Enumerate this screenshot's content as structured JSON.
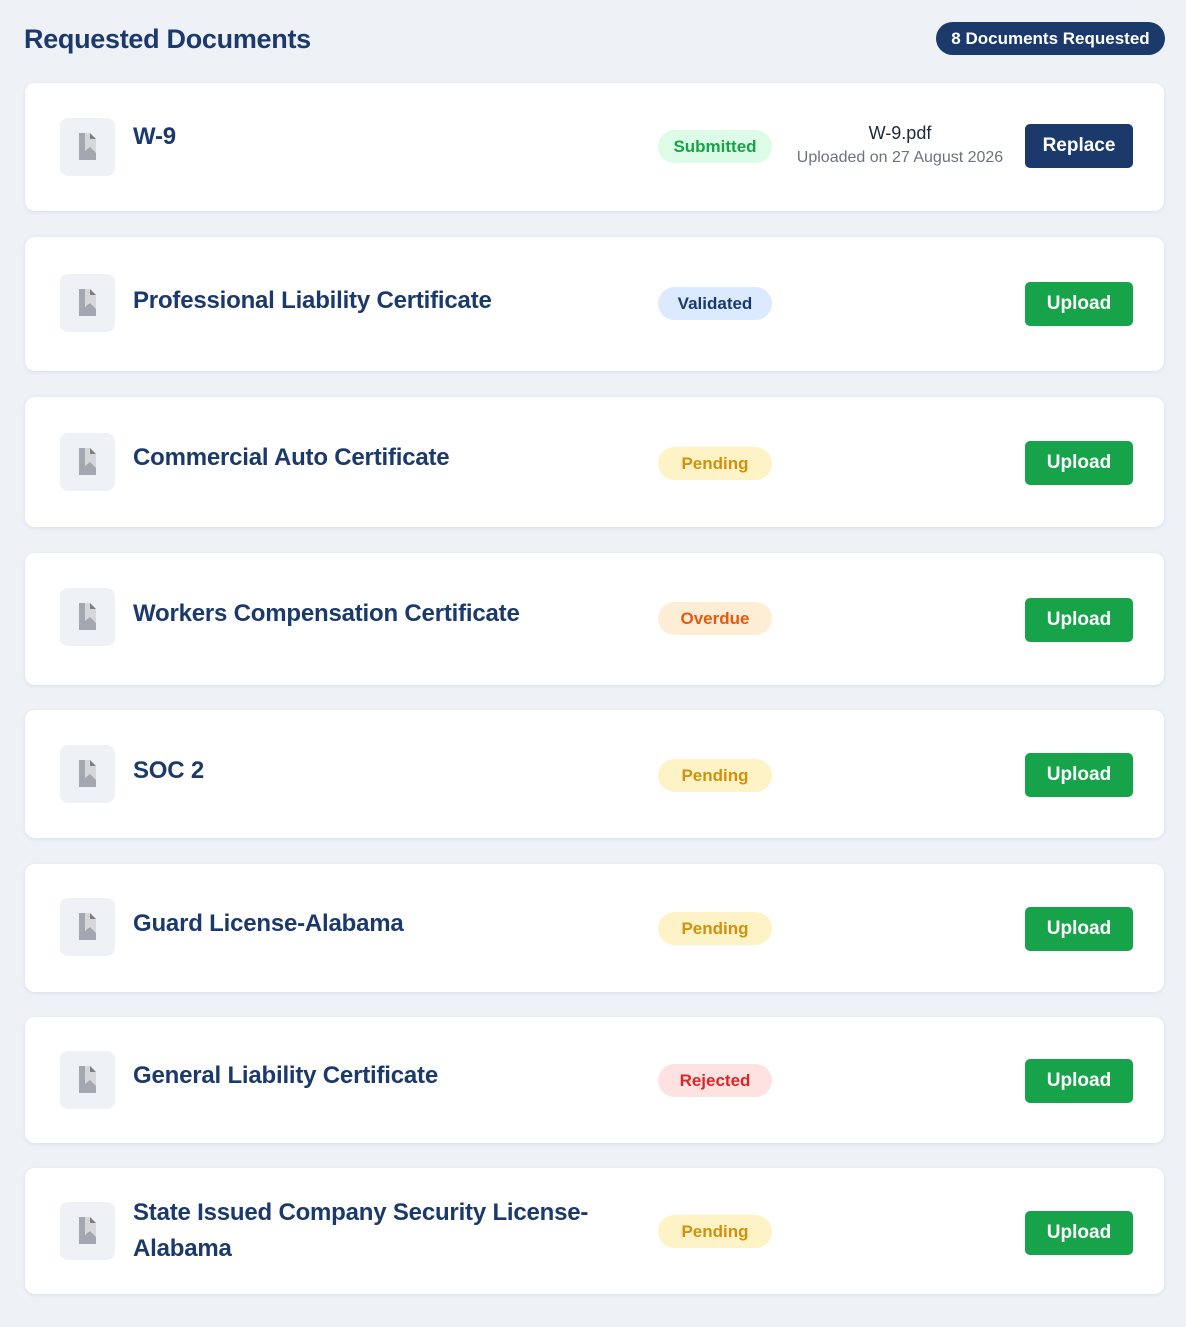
{
  "header": {
    "title": "Requested Documents",
    "count_badge": "8 Documents Requested"
  },
  "colors": {
    "navy": "#1b3a6b",
    "upload_green": "#16a34a",
    "page_bg": "#eef2f7"
  },
  "documents": [
    {
      "title": "W-9",
      "status": "Submitted",
      "status_style": "submitted",
      "file_name": "W-9.pdf",
      "uploaded_text": "Uploaded on 27 August 2026",
      "action": "Replace",
      "action_style": "replace"
    },
    {
      "title": "Professional Liability Certificate",
      "status": "Validated",
      "status_style": "validated",
      "action": "Upload",
      "action_style": "upload"
    },
    {
      "title": "Commercial Auto Certificate",
      "status": "Pending",
      "status_style": "pending",
      "action": "Upload",
      "action_style": "upload"
    },
    {
      "title": "Workers Compensation Certificate",
      "status": "Overdue",
      "status_style": "overdue",
      "action": "Upload",
      "action_style": "upload"
    },
    {
      "title": "SOC 2",
      "status": "Pending",
      "status_style": "pending",
      "action": "Upload",
      "action_style": "upload"
    },
    {
      "title": "Guard License-Alabama",
      "status": "Pending",
      "status_style": "pending",
      "action": "Upload",
      "action_style": "upload"
    },
    {
      "title": "General Liability Certificate",
      "status": "Rejected",
      "status_style": "rejected",
      "action": "Upload",
      "action_style": "upload"
    },
    {
      "title": "State Issued Company Security License-Alabama",
      "status": "Pending",
      "status_style": "pending",
      "action": "Upload",
      "action_style": "upload"
    }
  ],
  "status_colors": {
    "submitted": {
      "bg": "#dcfce7",
      "fg": "#16a34a"
    },
    "validated": {
      "bg": "#dbeafe",
      "fg": "#1b3a6b"
    },
    "pending": {
      "bg": "#fef3c7",
      "fg": "#d4900a"
    },
    "overdue": {
      "bg": "#ffedd5",
      "fg": "#ea580c"
    },
    "rejected": {
      "bg": "#fee2e2",
      "fg": "#dc2626"
    }
  },
  "icons": {
    "document": "document-icon"
  }
}
